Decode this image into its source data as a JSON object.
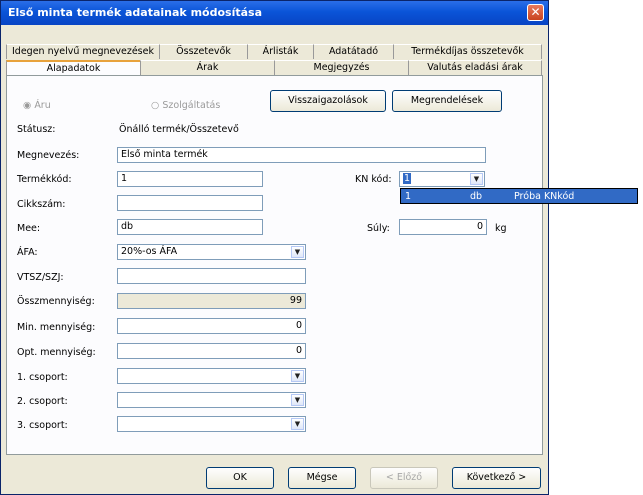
{
  "window": {
    "title": "Első minta termék adatainak módosítása"
  },
  "tabs": {
    "row_back": [
      "Idegen nyelvű megnevezések",
      "Összetevők",
      "Árlisták",
      "Adatátadó",
      "Termékdíjas összetevők"
    ],
    "row_front": [
      "Alapadatok",
      "Árak",
      "Megjegyzés",
      "Valutás eladási árak"
    ],
    "active": "Alapadatok"
  },
  "type_radios": {
    "aru": "Áru",
    "szolgaltatas": "Szolgáltatás"
  },
  "buttons": {
    "visszaigazolasok": "Visszaigazolások",
    "megrendelesek": "Megrendelések",
    "ok": "OK",
    "megse": "Mégse",
    "elozo": "< Előző",
    "kovetkezo": "Következő >"
  },
  "form": {
    "statusz_label": "Státusz:",
    "statusz_value": "Önálló termék/Összetevő",
    "megnevezes_label": "Megnevezés:",
    "megnevezes_value": "Első minta termék",
    "termekkod_label": "Termékkód:",
    "termekkod_value": "1",
    "cikkszam_label": "Cikkszám:",
    "cikkszam_value": "",
    "mee_label": "Mee:",
    "mee_value": "db",
    "afa_label": "ÁFA:",
    "afa_value": "20%-os ÁFA",
    "vtsz_label": "VTSZ/SZJ:",
    "vtsz_value": "",
    "osszmennyiseg_label": "Összmennyiség:",
    "osszmennyiseg_value": "99",
    "min_label": "Min. mennyiség:",
    "min_value": "0",
    "opt_label": "Opt. mennyiség:",
    "opt_value": "0",
    "csoport1_label": "1. csoport:",
    "csoport2_label": "2. csoport:",
    "csoport3_label": "3. csoport:",
    "knkod_label": "KN kód:",
    "knkod_value": "1",
    "suly_label": "Súly:",
    "suly_value": "0",
    "suly_unit": "kg"
  },
  "kn_popup": {
    "col1": "1",
    "col2": "db",
    "col3": "Próba KNkód"
  }
}
